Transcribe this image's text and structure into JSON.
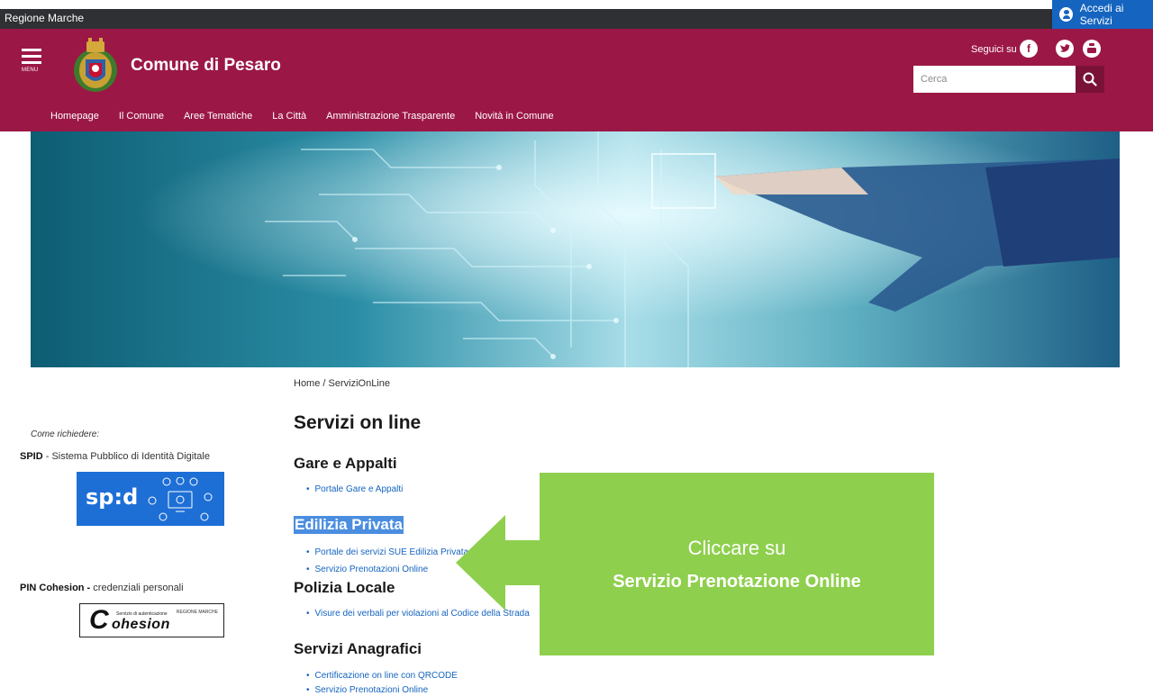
{
  "topbar": {
    "region": "Regione Marche",
    "login_label": "Accedi ai Servizi"
  },
  "header": {
    "menu_label": "MENU",
    "site_title": "Comune di Pesaro",
    "follow_label": "Seguici su",
    "search_placeholder": "Cerca",
    "nav": [
      "Homepage",
      "Il Comune",
      "Aree Tematiche",
      "La Città",
      "Amministrazione Trasparente",
      "Novità in Comune"
    ]
  },
  "sidebar": {
    "how_to": "Come richiedere:",
    "spid_bold": "SPID",
    "spid_text": " - Sistema Pubblico di Identità Digitale",
    "spid_logo": "sp:d",
    "pin_bold": "PIN Cohesion -",
    "pin_text": " credenziali personali",
    "cohesion_small": "Servizio di autenticazione",
    "cohesion_word": "ohesion",
    "cohesion_c": "C",
    "cohesion_region": "REGIONE MARCHE"
  },
  "main": {
    "breadcrumb": "Home /  ServiziOnLine",
    "title": "Servizi on line",
    "sections": [
      {
        "title": "Gare e Appalti",
        "links": [
          "Portale Gare e Appalti"
        ]
      },
      {
        "title": "Edilizia Privata",
        "links": [
          "Portale dei servizi SUE Edilizia Privata",
          "Servizio Prenotazioni Online"
        ]
      },
      {
        "title": "Polizia Locale",
        "links": [
          "Visure dei verbali per violazioni al Codice della Strada"
        ]
      },
      {
        "title": "Servizi Anagrafici",
        "links": [
          "Certificazione on line con QRCODE",
          "Servizio Prenotazioni Online"
        ]
      }
    ]
  },
  "annotation": {
    "line1": "Cliccare su",
    "line2": "Servizio Prenotazione Online",
    "color": "#8fcf4e"
  },
  "colors": {
    "header": "#9b1746",
    "topbar": "#2f3033",
    "link": "#1565c0",
    "login": "#1565c0"
  }
}
